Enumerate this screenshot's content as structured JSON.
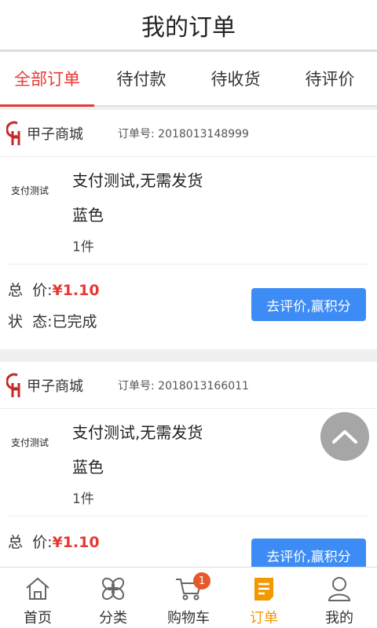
{
  "header": {
    "title": "我的订单"
  },
  "tabs": [
    {
      "label": "全部订单"
    },
    {
      "label": "待付款"
    },
    {
      "label": "待收货"
    },
    {
      "label": "待评价"
    }
  ],
  "orders": [
    {
      "shop_name": "甲子商城",
      "order_no": "订单号: 2018013148999",
      "thumb_text": "支付测试",
      "goods_title": "支付测试,无需发货",
      "goods_color": "蓝色",
      "goods_qty": "1件",
      "total_label": "总  价:",
      "total_price": "¥1.10",
      "status_label": "状  态:",
      "status_value": "已完成",
      "action_label": "去评价,赢积分"
    },
    {
      "shop_name": "甲子商城",
      "order_no": "订单号: 2018013166011",
      "thumb_text": "支付测试",
      "goods_title": "支付测试,无需发货",
      "goods_color": "蓝色",
      "goods_qty": "1件",
      "total_label": "总  价:",
      "total_price": "¥1.10",
      "action_label": "去评价,赢积分"
    }
  ],
  "bottom_nav": [
    {
      "label": "首页",
      "icon": "home-icon"
    },
    {
      "label": "分类",
      "icon": "category-icon"
    },
    {
      "label": "购物车",
      "icon": "cart-icon",
      "badge": "1"
    },
    {
      "label": "订单",
      "icon": "order-icon"
    },
    {
      "label": "我的",
      "icon": "user-icon"
    }
  ],
  "colors": {
    "accent_red": "#e53935",
    "button_blue": "#3d8cf5",
    "active_orange": "#f39800"
  }
}
